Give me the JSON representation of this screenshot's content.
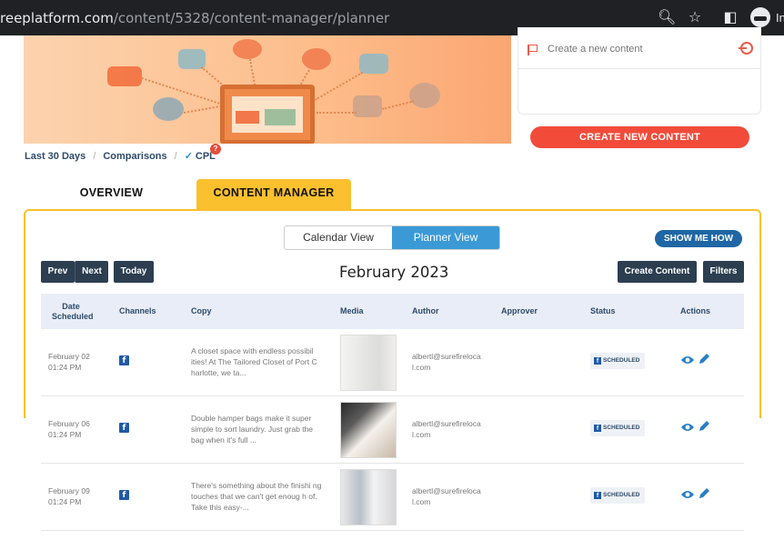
{
  "browser": {
    "url_host": "reeplatform.com",
    "url_path": "/content/5328/content-manager/planner",
    "partial_profile_text": "In"
  },
  "right_panel": {
    "create_new_content_label": "Create a new content",
    "create_button": "CREATE NEW CONTENT"
  },
  "breadcrumbs": {
    "range": "Last 30 Days",
    "comparisons": "Comparisons",
    "metric": "CPL",
    "badge": "?"
  },
  "tabs": {
    "overview": "OVERVIEW",
    "content_manager": "CONTENT MANAGER"
  },
  "planner": {
    "view_toggle": [
      "Calendar View",
      "Planner View"
    ],
    "active_view": "Planner View",
    "show_me_how": "SHOW ME HOW",
    "prev": "Prev",
    "next": "Next",
    "today": "Today",
    "month": "February 2023",
    "create_content": "Create Content",
    "filters": "Filters",
    "columns": {
      "date": "Date Scheduled",
      "channels": "Channels",
      "copy": "Copy",
      "media": "Media",
      "author": "Author",
      "approver": "Approver",
      "status": "Status",
      "actions": "Actions"
    },
    "rows": [
      {
        "date": "February 02",
        "time": "01:24 PM",
        "channel": "facebook-icon",
        "copy": "A closet space with endless possibil ities! At The Tailored Closet of Port C harlotte, we ta...",
        "author": "albertl@surefireloca l.com",
        "approver": "",
        "status": "SCHEDULED"
      },
      {
        "date": "February 06",
        "time": "01:24 PM",
        "channel": "facebook-icon",
        "copy": "Double hamper bags make it super simple to sort laundry. Just grab the bag when it's full ...",
        "author": "albertl@surefireloca l.com",
        "approver": "",
        "status": "SCHEDULED"
      },
      {
        "date": "February 09",
        "time": "01:24 PM",
        "channel": "facebook-icon",
        "copy": "There's something about the finishi ng touches that we can't get enoug h of. Take this easy-...",
        "author": "albertl@surefireloca l.com",
        "approver": "",
        "status": "SCHEDULED"
      }
    ]
  },
  "colors": {
    "accent_yellow": "#fbc02d",
    "create_red": "#f24b3a",
    "planner_blue": "#3b9ad6",
    "dark_button": "#2c3e50",
    "facebook_blue": "#1f5aa6"
  }
}
